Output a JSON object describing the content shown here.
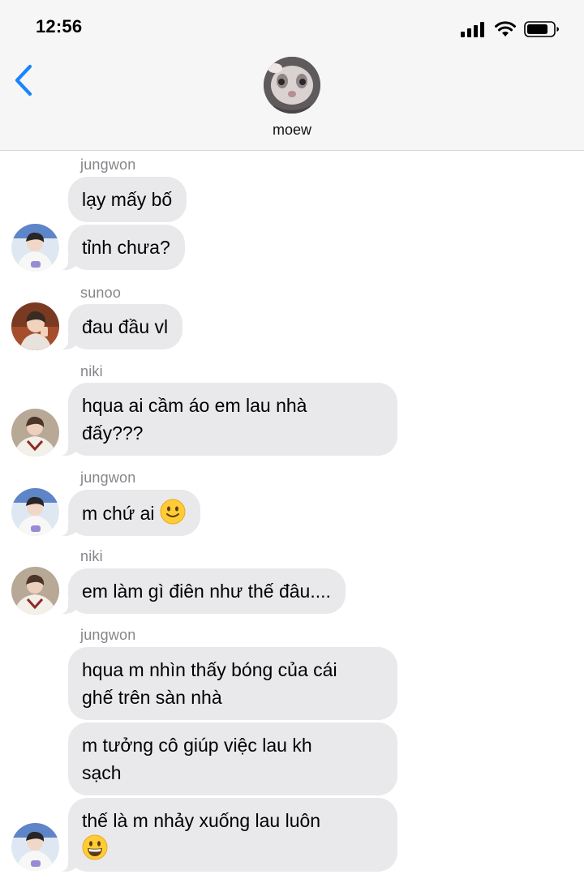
{
  "status_bar": {
    "time": "12:56",
    "icons": [
      "signal-icon",
      "wifi-icon",
      "battery-icon"
    ]
  },
  "header": {
    "back_icon": "chevron-left-icon",
    "group_name": "moew",
    "accent_color": "#1a84ff"
  },
  "colors": {
    "bubble_bg": "#e9e9eb",
    "header_bg": "#f6f6f7",
    "sender_text": "#86868b"
  },
  "messages": [
    {
      "sender": "jungwon",
      "lines": [
        "lạy mấy bố"
      ]
    },
    {
      "sender": "jungwon",
      "lines": [
        "tỉnh chưa?"
      ]
    },
    {
      "sender": "sunoo",
      "lines": [
        "đau đầu vl"
      ]
    },
    {
      "sender": "niki",
      "lines": [
        "hqua ai cầm áo em lau nhà",
        "đấy???"
      ]
    },
    {
      "sender": "jungwon",
      "lines": [
        "m chứ ai"
      ],
      "emoji": "slightly-smiling-face"
    },
    {
      "sender": "niki",
      "lines": [
        "em làm gì điên như thế đâu...."
      ]
    },
    {
      "sender": "jungwon",
      "lines": [
        "hqua m nhìn thấy bóng của cái",
        "ghế trên sàn nhà"
      ]
    },
    {
      "sender": "jungwon",
      "lines": [
        "m tưởng cô giúp việc lau kh",
        "sạch"
      ]
    },
    {
      "sender": "jungwon",
      "lines": [
        "thế là m nhảy xuống lau luôn"
      ],
      "emoji": "grinning-face"
    }
  ]
}
